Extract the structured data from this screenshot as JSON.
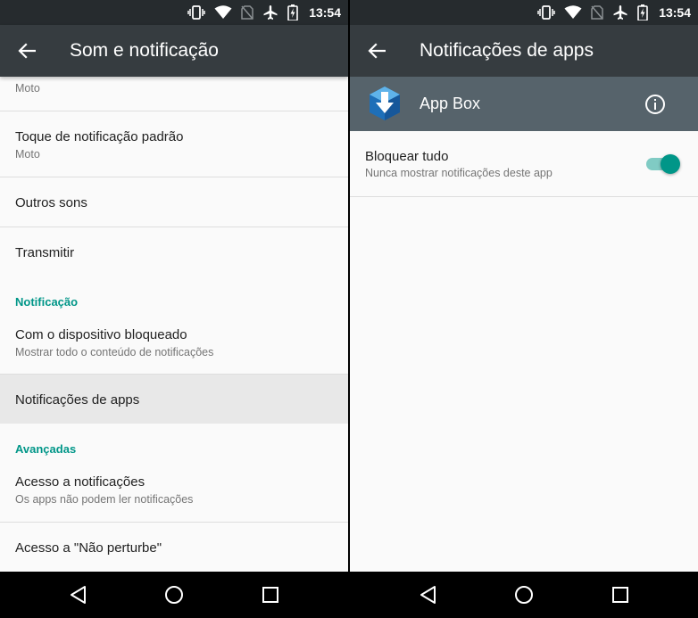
{
  "status_bar": {
    "time": "13:54",
    "icons": [
      "vibrate-icon",
      "wifi-icon",
      "no-sim-icon",
      "airplane-icon",
      "battery-charging-icon"
    ]
  },
  "left_screen": {
    "toolbar": {
      "title": "Som e notificação"
    },
    "items": [
      {
        "secondary": "Moto"
      },
      {
        "primary": "Toque de notificação padrão",
        "secondary": "Moto"
      },
      {
        "primary": "Outros sons"
      },
      {
        "primary": "Transmitir"
      },
      {
        "primary": "Com o dispositivo bloqueado",
        "secondary": "Mostrar todo o conteúdo de notificações"
      },
      {
        "primary": "Notificações de apps"
      },
      {
        "primary": "Acesso a notificações",
        "secondary": "Os apps não podem ler notificações"
      },
      {
        "primary": "Acesso a \"Não perturbe\""
      }
    ],
    "sections": {
      "notification": "Notificação",
      "advanced": "Avançadas"
    }
  },
  "right_screen": {
    "toolbar": {
      "title": "Notificações de apps"
    },
    "app": {
      "name": "App Box",
      "icon": "app-box-icon"
    },
    "block_all": {
      "primary": "Bloquear tudo",
      "secondary": "Nunca mostrar notificações deste app",
      "enabled": true
    }
  },
  "colors": {
    "accent": "#009688",
    "toolbar": "#363c40",
    "status_bar": "#262b2e",
    "app_header": "#56636b",
    "highlight_row": "#e8e8e8"
  }
}
